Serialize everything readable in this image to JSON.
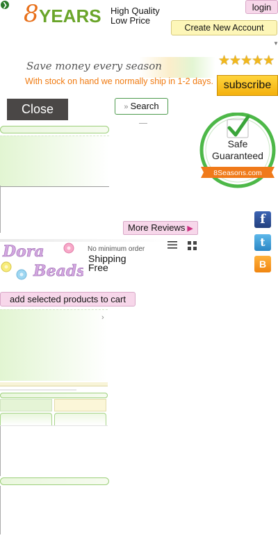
{
  "header": {
    "logo_number": "8",
    "logo_word": "YEARS",
    "tagline_line1": "High Quality",
    "tagline_line2": "Low Price",
    "login_label": "login",
    "create_account_label": "Create New Account"
  },
  "banner": {
    "slogan": "Save money every season",
    "shipping_note": "With stock on hand we normally ship in 1-2 days.",
    "rating_stars": 5,
    "subscribe_label": "subscribe"
  },
  "controls": {
    "close_label": "Close",
    "search_label": "Search"
  },
  "badge": {
    "line1": "Safe",
    "line2": "Guaranteed",
    "site": "8Seasons.com",
    "colors": {
      "ring": "#4db848",
      "ribbon": "#f07a1a"
    }
  },
  "reviews": {
    "more_label": "More Reviews"
  },
  "social": {
    "facebook": "f",
    "twitter": "t",
    "blogger": "B"
  },
  "shop": {
    "logo_line1": "Dora",
    "logo_line2": "Beads",
    "min_order": "No minimum order",
    "shipping_line1": "Shipping",
    "shipping_line2": "Free",
    "menu_icon": "hamburger-icon",
    "grid_icon": "grid-icon",
    "add_to_cart_label": "add selected products to cart"
  },
  "colors": {
    "accent_green": "#6aa52a",
    "accent_orange": "#f07a10",
    "pink_button": "#f7d7ea",
    "yellow_button": "#fdf6b8"
  }
}
